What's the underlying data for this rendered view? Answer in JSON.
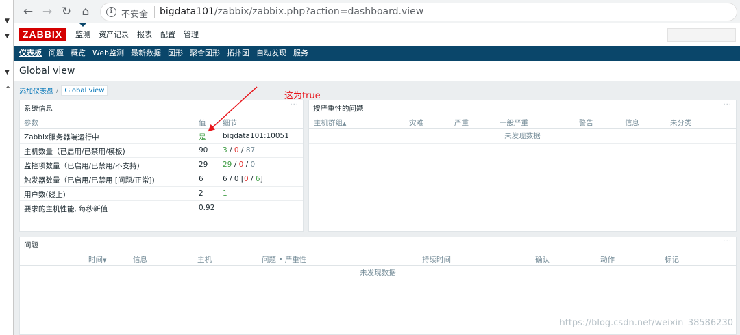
{
  "browser": {
    "security_label": "不安全",
    "url_host": "bigdata101",
    "url_path": "/zabbix/zabbix.php?action=dashboard.view"
  },
  "header": {
    "logo": "ZABBIX",
    "menu": [
      "监测",
      "资产记录",
      "报表",
      "配置",
      "管理"
    ]
  },
  "submenu": [
    "仪表板",
    "问题",
    "概览",
    "Web监测",
    "最新数据",
    "图形",
    "聚合图形",
    "拓扑图",
    "自动发现",
    "服务"
  ],
  "page": {
    "title": "Global view",
    "breadcrumb_link": "添加仪表盘",
    "breadcrumb_sep": "/",
    "breadcrumb_current": "Global view"
  },
  "annotation": "这为true",
  "sysinfo": {
    "title": "系统信息",
    "menu_dots": "···",
    "columns": {
      "param": "参数",
      "value": "值",
      "detail": "细节"
    },
    "rows": {
      "r0": {
        "param": "Zabbix服务器端运行中",
        "value": "是",
        "detail": "bigdata101:10051"
      },
      "r1": {
        "param": "主机数量（已启用/已禁用/模板)",
        "value": "90",
        "d1": "3",
        "s1": " / ",
        "d2": "0",
        "s2": " / ",
        "d3": "87"
      },
      "r2": {
        "param": "监控项数量（已启用/已禁用/不支持)",
        "value": "29",
        "d1": "29",
        "s1": " / ",
        "d2": "0",
        "s2": " / ",
        "d3": "0"
      },
      "r3": {
        "param": "触发器数量（已启用/已禁用 [问题/正常])",
        "value": "6",
        "d_prefix": "6 / 0 [",
        "d1": "0",
        "s1": " / ",
        "d2": "6",
        "d_suffix": "]"
      },
      "r4": {
        "param": "用户数(线上)",
        "value": "2",
        "d1": "1"
      },
      "r5": {
        "param": "要求的主机性能, 每秒新值",
        "value": "0.92"
      }
    }
  },
  "severity": {
    "title": "按严重性的问题",
    "menu_dots": "···",
    "columns": {
      "hostgroup": "主机群组",
      "sort": "▲",
      "disaster": "灾难",
      "high": "严重",
      "average": "一般严重",
      "warning": "警告",
      "info": "信息",
      "unclassified": "未分类"
    },
    "empty": "未发现数据"
  },
  "problems": {
    "title": "问题",
    "menu_dots": "···",
    "columns": {
      "time": "时间",
      "time_sort": "▼",
      "info": "信息",
      "host": "主机",
      "problem": "问题 • 严重性",
      "duration": "持续时间",
      "ack": "确认",
      "actions": "动作",
      "tags": "标记"
    },
    "empty": "未发现数据"
  },
  "watermark": "https://blog.csdn.net/weixin_38586230",
  "colors": {
    "accent": "#0a466a",
    "logo": "#d40000",
    "annotation": "#e8161c",
    "ok": "#429e47",
    "problem": "#e33734"
  }
}
